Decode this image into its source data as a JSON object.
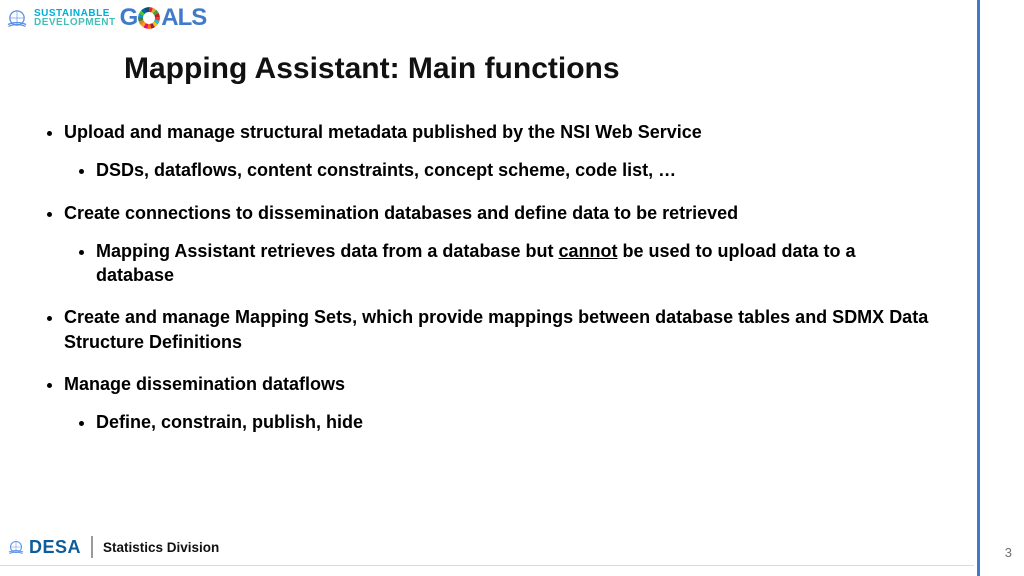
{
  "header": {
    "sdg_line1": "SUSTAINABLE",
    "sdg_line2": "DEVELOPMENT",
    "goals_prefix": "G",
    "goals_suffix": "ALS"
  },
  "title": "Mapping Assistant: Main functions",
  "bullets": {
    "b1": "Upload and manage structural metadata published by the NSI Web Service",
    "b1a": "DSDs, dataflows, content constraints, concept scheme, code list, …",
    "b2": "Create connections to dissemination databases and define data to be retrieved",
    "b2a_pre": "Mapping Assistant retrieves data from a database but ",
    "b2a_u": "cannot",
    "b2a_post": " be used to upload data to a database",
    "b3": "Create and manage Mapping Sets, which provide mappings between database tables and SDMX Data Structure Definitions",
    "b4": "Manage dissemination dataflows",
    "b4a": "Define, constrain, publish, hide"
  },
  "footer": {
    "desa": "DESA",
    "subdivision": "Statistics Division",
    "page": "3"
  },
  "colors": {
    "accent_blue": "#3f7bc9",
    "un_blue": "#5b92e5"
  }
}
